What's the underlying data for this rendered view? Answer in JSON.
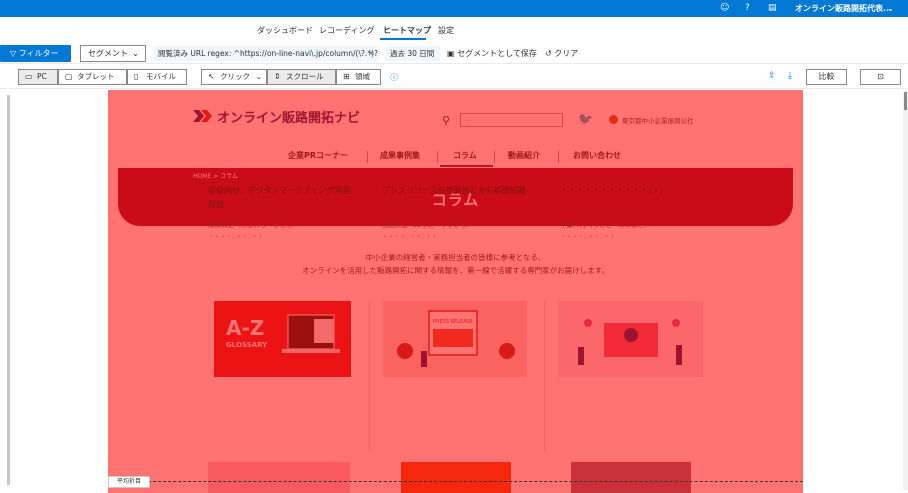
{
  "topbar": {
    "account_name": "オンライン販路開拓代表...",
    "icons": [
      "smiley-icon",
      "help-icon",
      "document-icon",
      "chevron-down-icon"
    ]
  },
  "nav": {
    "tabs": [
      {
        "label": "ダッシュボード",
        "active": false
      },
      {
        "label": "レコーディング",
        "active": false
      },
      {
        "label": "ヒートマップ",
        "active": true
      },
      {
        "label": "設定",
        "active": false
      }
    ]
  },
  "filters": {
    "filter_label": "フィルター",
    "segment_label": "セグメント",
    "url_chip": "閲覧済み URL regex: ^https://on-line-navi\\.jp/column/(\\?.*)?$",
    "date_chip": "過去 30 日間",
    "save_segment": "セグメントとして保存",
    "clear": "クリア"
  },
  "toolbar": {
    "devices": [
      {
        "label": "PC",
        "selected": true
      },
      {
        "label": "タブレット",
        "selected": false
      },
      {
        "label": "モバイル",
        "selected": false
      }
    ],
    "modes": [
      {
        "label": "クリック",
        "selected": false
      },
      {
        "label": "スクロール",
        "selected": true
      },
      {
        "label": "領域",
        "selected": false
      }
    ],
    "compare_label": "比較"
  },
  "site": {
    "logo_text": "オンライン販路開拓ナビ",
    "search_placeholder": "...",
    "partner_text": "東京都中小企業振興公社",
    "nav_items": [
      "企業PRコーナー",
      "成果事例集",
      "コラム",
      "動画紹介",
      "お問い合わせ"
    ],
    "breadcrumb": "HOME  >  コラム",
    "hero_title": "コラム",
    "intro_line1": "中小企業の経営者・実務担当者の皆様に参考となる、",
    "intro_line2": "オンラインを活用した販路開拓に関する情報を、第一線で活躍する専門家がお届けします。",
    "cards": [
      {
        "title": "初級向け、デジタルマーケティング用語用語",
        "author": "藤原莉史（ふじわら・さとし）",
        "date": "・・・・. ・・. ・・"
      },
      {
        "title": "プレスリリースの重要性とその基礎知識",
        "author": "田田英宏（はらだ・やすひろ）",
        "date": "・・・・. ・・. ・・"
      },
      {
        "title": "・・・・・・・・・・・（・）",
        "author": "千葉梓乃（ちささ・のぶあき）",
        "date": "・・・・. ・・. ・・"
      }
    ],
    "card1_image_text": "A-Z",
    "card1_image_sub": "GLOSSARY",
    "card2_image_text": "PRESS RELEASE"
  },
  "fold": {
    "label": "平均折目"
  },
  "colors": {
    "accent": "#0078d4",
    "heat": "#ff3b3b",
    "hero": "#8a1b36"
  }
}
